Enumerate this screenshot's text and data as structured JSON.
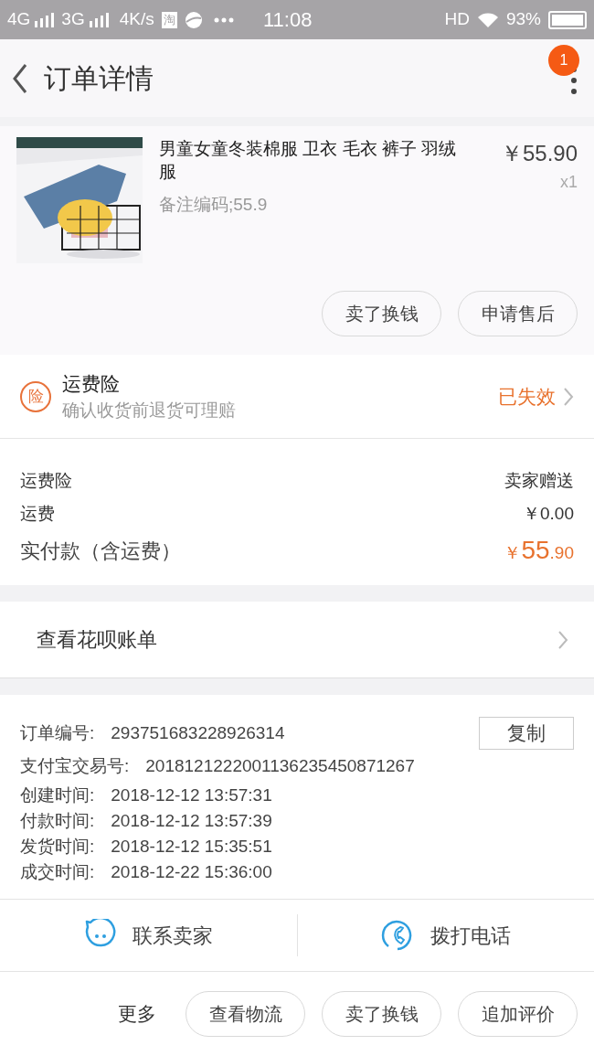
{
  "status_bar": {
    "left": [
      "4G",
      "3G",
      "4K/s",
      "淘"
    ],
    "time": "11:08",
    "hd": "HD",
    "battery": "93%"
  },
  "header": {
    "title": "订单详情",
    "badge": "1"
  },
  "product": {
    "title": "男童女童冬装棉服 卫衣 毛衣 裤子 羽绒服",
    "note": "备注编码;55.9",
    "price": "￥55.90",
    "quantity": "x1",
    "buttons": [
      "卖了换钱",
      "申请售后"
    ]
  },
  "insurance": {
    "icon_char": "险",
    "title": "运费险",
    "subtitle": "确认收货前退货可理赔",
    "status": "已失效"
  },
  "fees": [
    {
      "label": "运费险",
      "value": "卖家赠送"
    },
    {
      "label": "运费",
      "value": "￥0.00"
    }
  ],
  "total": {
    "label": "实付款（含运费）",
    "currency": "￥",
    "main": "55",
    "fraction": ".90"
  },
  "huabei": {
    "label": "查看花呗账单"
  },
  "order_info": {
    "copy_button": "复制",
    "rows": [
      {
        "label": "订单编号:",
        "value": "293751683228926314"
      },
      {
        "label": "支付宝交易号:",
        "value": "2018121222001136235450871267"
      },
      {
        "label": "创建时间:",
        "value": "2018-12-12 13:57:31"
      },
      {
        "label": "付款时间:",
        "value": "2018-12-12 13:57:39"
      },
      {
        "label": "发货时间:",
        "value": "2018-12-12 15:35:51"
      },
      {
        "label": "成交时间:",
        "value": "2018-12-22 15:36:00"
      }
    ]
  },
  "contact": [
    {
      "kind": "chat",
      "label": "联系卖家"
    },
    {
      "kind": "phone",
      "label": "拨打电话"
    }
  ],
  "more": {
    "label": "更多",
    "buttons": [
      "查看物流",
      "卖了换钱",
      "追加评价"
    ]
  }
}
